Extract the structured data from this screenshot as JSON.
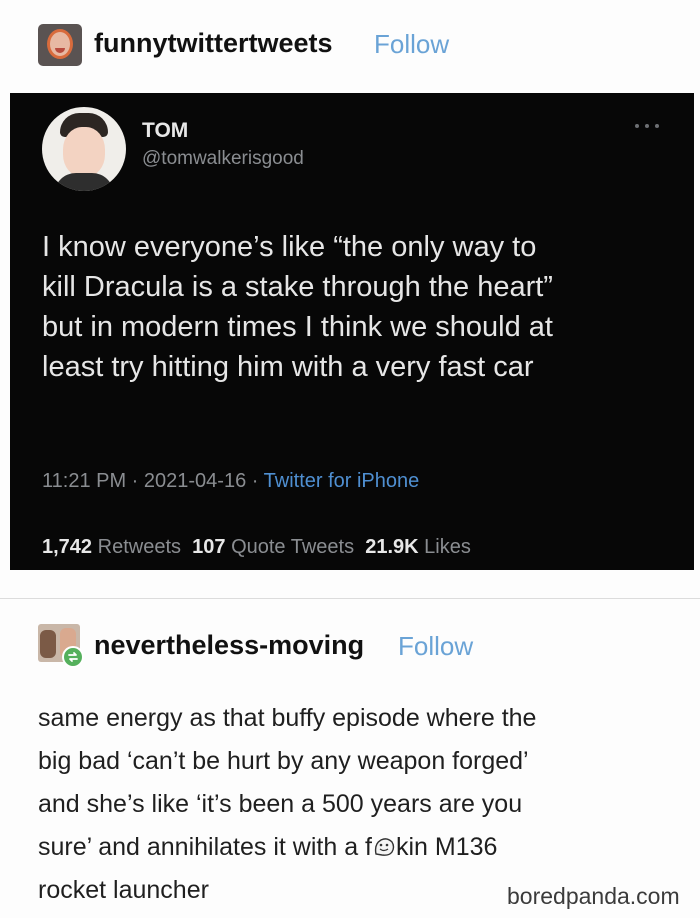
{
  "first_post": {
    "username": "funnytwittertweets",
    "follow_label": "Follow",
    "avatar_icon": "user-avatar-icon"
  },
  "tweet": {
    "display_name": "TOM",
    "handle": "@tomwalkerisgood",
    "more_icon": "more-dots-icon",
    "lines": [
      "I know everyone’s like “the only way to",
      "kill Dracula is a stake through the heart”",
      "but in modern times I think we should at",
      "least try hitting him with a very fast car"
    ],
    "time": "11:21 PM",
    "date": "2021-04-16",
    "source": "Twitter for iPhone",
    "retweets_count": "1,742",
    "retweets_label": "Retweets",
    "quotes_count": "107",
    "quotes_label": "Quote Tweets",
    "likes_count": "21.9K",
    "likes_label": "Likes",
    "background_color": "#070707",
    "link_color": "#4f8fd1"
  },
  "second_post": {
    "username": "nevertheless-moving",
    "follow_label": "Follow",
    "reblog_icon": "reblog-icon",
    "lines": [
      "same energy as that buffy episode where the",
      "big bad ‘can’t be hurt by any weapon forged’",
      "and she’s like ‘it’s been a 500 years are you"
    ],
    "line4_start": "sure’ and annihilates it with a f",
    "line4_emoji": "face-emoji-icon",
    "line4_end": "kin M136",
    "line5": "rocket launcher"
  },
  "watermark": "boredpanda.com",
  "colors": {
    "follow": "#6aa3d6",
    "reblog_badge": "#55b05c"
  }
}
